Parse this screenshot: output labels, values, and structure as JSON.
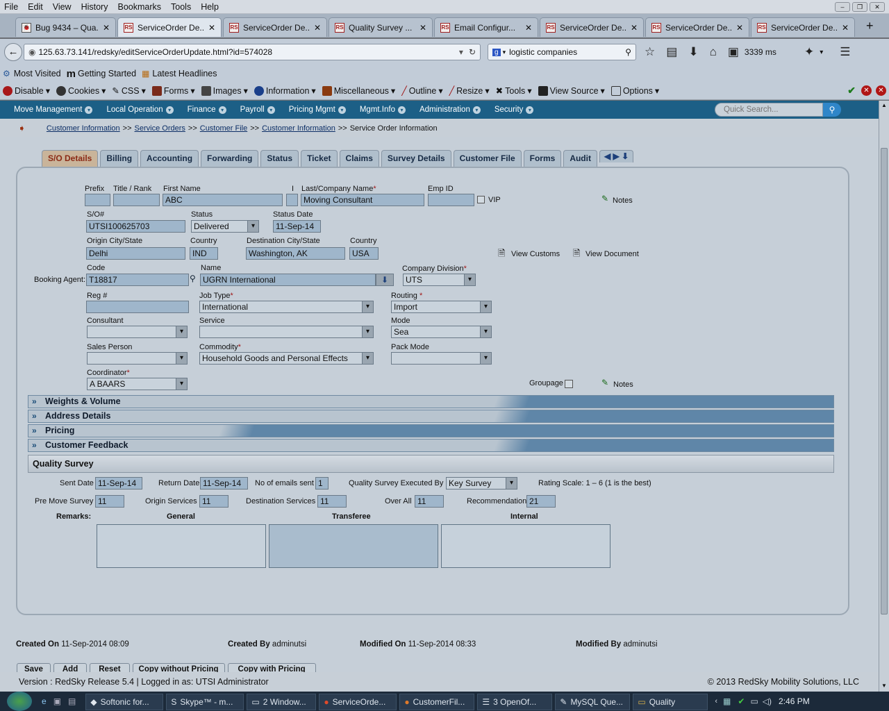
{
  "menubar": {
    "items": [
      "File",
      "Edit",
      "View",
      "History",
      "Bookmarks",
      "Tools",
      "Help"
    ]
  },
  "tabs": [
    {
      "label": "Bug 9434 – Qua...",
      "icon": "bug-icon"
    },
    {
      "label": "ServiceOrder De...",
      "icon": "redsky-icon"
    },
    {
      "label": "ServiceOrder De...",
      "icon": "redsky-icon"
    },
    {
      "label": "Quality Survey ...",
      "icon": "redsky-icon"
    },
    {
      "label": "Email Configur...",
      "icon": "redsky-icon"
    },
    {
      "label": "ServiceOrder De...",
      "icon": "redsky-icon"
    },
    {
      "label": "ServiceOrder De...",
      "icon": "redsky-icon"
    },
    {
      "label": "ServiceOrder De...",
      "icon": "redsky-icon"
    }
  ],
  "nav": {
    "url": "125.63.73.141/redsky/editServiceOrderUpdate.html?id=574028",
    "search": "logistic companies",
    "timing": "3339 ms"
  },
  "bookmarks": [
    "Most Visited",
    "Getting Started",
    "Latest Headlines"
  ],
  "devbar": [
    "Disable",
    "Cookies",
    "CSS",
    "Forms",
    "Images",
    "Information",
    "Miscellaneous",
    "Outline",
    "Resize",
    "Tools",
    "View Source",
    "Options"
  ],
  "appnav": {
    "items": [
      "Move Management",
      "Local Operation",
      "Finance",
      "Payroll",
      "Pricing Mgmt",
      "Mgmt.Info",
      "Administration",
      "Security"
    ],
    "search_placeholder": "Quick Search..."
  },
  "breadcrumb": {
    "links": [
      "Customer Information",
      "Service Orders",
      "Customer File",
      "Customer Information"
    ],
    "current": "Service Order Information",
    "sep": ">>"
  },
  "so_tabs": [
    "S/O Details",
    "Billing",
    "Accounting",
    "Forwarding",
    "Status",
    "Ticket",
    "Claims",
    "Survey Details",
    "Customer File",
    "Forms",
    "Audit"
  ],
  "form": {
    "prefix_label": "Prefix",
    "title_label": "Title / Rank",
    "first_name_label": "First Name",
    "first_name": "ABC",
    "mi_label": "I",
    "last_name_label": "Last/Company Name",
    "last_name": "Moving Consultant",
    "emp_id_label": "Emp ID",
    "vip_label": "VIP",
    "notes_label": "Notes",
    "so_label": "S/O#",
    "so": "UTSI100625703",
    "status_label": "Status",
    "status": "Delivered",
    "status_date_label": "Status Date",
    "status_date": "11-Sep-14",
    "origin_label": "Origin City/State",
    "origin": "Delhi",
    "country_label": "Country",
    "origin_country": "IND",
    "dest_label": "Destination City/State",
    "dest": "Washington, AK",
    "dest_country": "USA",
    "view_customs": "View Customs",
    "view_document": "View Document",
    "booking_agent_label": "Booking Agent:",
    "code_label": "Code",
    "code": "T18817",
    "name_label": "Name",
    "name": "UGRN International",
    "company_div_label": "Company Division",
    "company_div": "UTS",
    "reg_label": "Reg #",
    "job_type_label": "Job Type",
    "job_type": "International",
    "routing_label": "Routing",
    "routing": "Import",
    "consultant_label": "Consultant",
    "service_label": "Service",
    "mode_label": "Mode",
    "mode": "Sea",
    "sales_label": "Sales Person",
    "commodity_label": "Commodity",
    "commodity": "Household Goods and Personal Effects",
    "pack_mode_label": "Pack Mode",
    "coordinator_label": "Coordinator",
    "coordinator": "A BAARS",
    "groupage_label": "Groupage",
    "notes2_label": "Notes"
  },
  "sections": [
    "Weights & Volume",
    "Address Details",
    "Pricing",
    "Customer Feedback"
  ],
  "quality": {
    "title": "Quality Survey",
    "sent_label": "Sent Date",
    "sent": "11-Sep-14",
    "return_label": "Return Date",
    "return": "11-Sep-14",
    "emails_label": "No of emails sent",
    "emails": "1",
    "exec_label": "Quality Survey Executed By",
    "exec": "Key Survey",
    "rating": "Rating Scale: 1 – 6 (1 is the best)",
    "pre_label": "Pre Move Survey",
    "pre": "11",
    "origin_label": "Origin Services",
    "origin": "11",
    "dest_label": "Destination Services",
    "dest": "11",
    "overall_label": "Over All",
    "overall": "11",
    "rec_label": "Recommendation",
    "rec": "21",
    "remarks_label": "Remarks:",
    "general": "General",
    "transferee": "Transferee",
    "internal": "Internal"
  },
  "meta": {
    "created_on_label": "Created On",
    "created_on": "11-Sep-2014 08:09",
    "created_by_label": "Created By",
    "created_by": "adminutsi",
    "modified_on_label": "Modified On",
    "modified_on": "11-Sep-2014 08:33",
    "modified_by_label": "Modified By",
    "modified_by": "adminutsi"
  },
  "buttons": [
    "Save",
    "Add",
    "Reset",
    "Copy without Pricing",
    "Copy with Pricing"
  ],
  "footer": {
    "version": "Version : RedSky Release 5.4 | Logged in as: UTSI Administrator",
    "copyright": "© 2013 RedSky Mobility Solutions, LLC"
  },
  "taskbar": {
    "items": [
      "Softonic for...",
      "Skype™ - m...",
      "2 Window...",
      "ServiceOrde...",
      "CustomerFil...",
      "3 OpenOf...",
      "MySQL Que...",
      "Quality"
    ],
    "clock": "2:46 PM"
  }
}
